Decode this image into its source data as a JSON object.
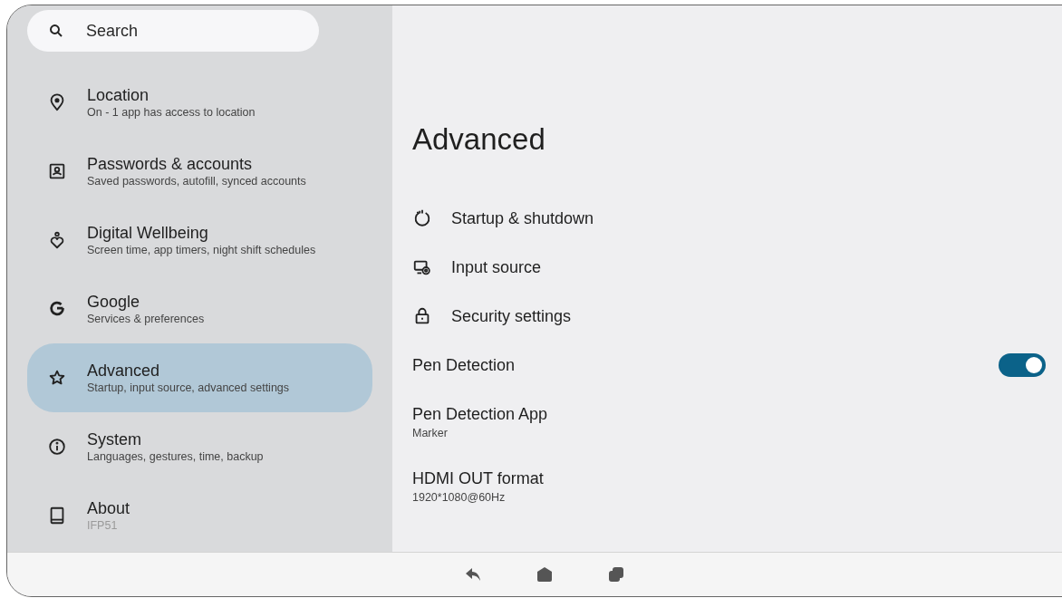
{
  "search": {
    "placeholder": "Search"
  },
  "sidebar": {
    "items": [
      {
        "title": "Location",
        "subtitle": "On - 1 app has access to location",
        "selected": false
      },
      {
        "title": "Passwords & accounts",
        "subtitle": "Saved passwords, autofill, synced accounts",
        "selected": false
      },
      {
        "title": "Digital Wellbeing",
        "subtitle": "Screen time, app timers, night shift schedules",
        "selected": false
      },
      {
        "title": "Google",
        "subtitle": "Services & preferences",
        "selected": false
      },
      {
        "title": "Advanced",
        "subtitle": "Startup, input source, advanced settings",
        "selected": true
      },
      {
        "title": "System",
        "subtitle": "Languages, gestures, time, backup",
        "selected": false
      },
      {
        "title": "About",
        "subtitle": "IFP51",
        "selected": false
      }
    ]
  },
  "page": {
    "title": "Advanced",
    "items": [
      {
        "kind": "link",
        "title": "Startup & shutdown"
      },
      {
        "kind": "link",
        "title": "Input source"
      },
      {
        "kind": "link",
        "title": "Security settings"
      },
      {
        "kind": "toggle",
        "title": "Pen Detection",
        "on": true
      },
      {
        "kind": "summary",
        "title": "Pen Detection App",
        "subtitle": "Marker"
      },
      {
        "kind": "summary",
        "title": "HDMI OUT format",
        "subtitle": "1920*1080@60Hz"
      }
    ]
  }
}
